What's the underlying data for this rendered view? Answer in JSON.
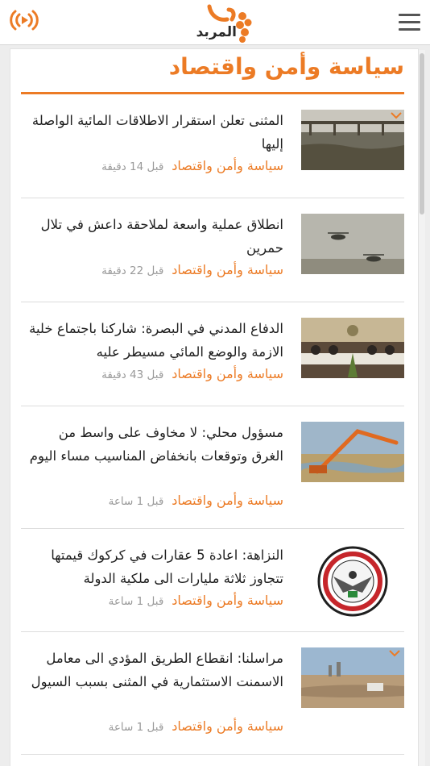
{
  "header": {
    "logo_text": "المربد",
    "live_icon": "radio-broadcast-icon",
    "menu_icon": "hamburger-menu-icon",
    "brand_color": "#ec7b25"
  },
  "section": {
    "title": "سياسة وأمن واقتصاد"
  },
  "articles": [
    {
      "headline": "المثنى تعلن استقرار الاطلاقات المائية الواصلة إليها",
      "category": "سياسة وأمن واقتصاد",
      "time": "قبل 14 دقيقة",
      "image": "river-bridge-photo"
    },
    {
      "headline": "انطلاق عملية واسعة لملاحقة داعش في تلال حمرين",
      "category": "سياسة وأمن واقتصاد",
      "time": "قبل 22 دقيقة",
      "image": "helicopters-photo"
    },
    {
      "headline": "الدفاع المدني في البصرة: شاركنا باجتماع خلية الازمة والوضع المائي مسيطر عليه",
      "category": "سياسة وأمن واقتصاد",
      "time": "قبل 43 دقيقة",
      "image": "meeting-room-photo"
    },
    {
      "headline": "مسؤول محلي: لا مخاوف على واسط من الغرق وتوقعات بانخفاض المناسيب مساء اليوم",
      "category": "سياسة وأمن واقتصاد",
      "time": "قبل 1 ساعة",
      "image": "excavator-flood-photo"
    },
    {
      "headline": "النزاهة: اعادة 5 عقارات في كركوك قيمتها تتجاوز ثلاثة مليارات الى ملكية الدولة",
      "category": "سياسة وأمن واقتصاد",
      "time": "قبل 1 ساعة",
      "image": "integrity-commission-emblem"
    },
    {
      "headline": "مراسلنا: انقطاع الطريق المؤدي الى معامل الاسمنت الاستثمارية في المثنى بسبب السيول",
      "category": "سياسة وأمن واقتصاد",
      "time": "قبل 1 ساعة",
      "image": "flooded-road-photo"
    }
  ]
}
